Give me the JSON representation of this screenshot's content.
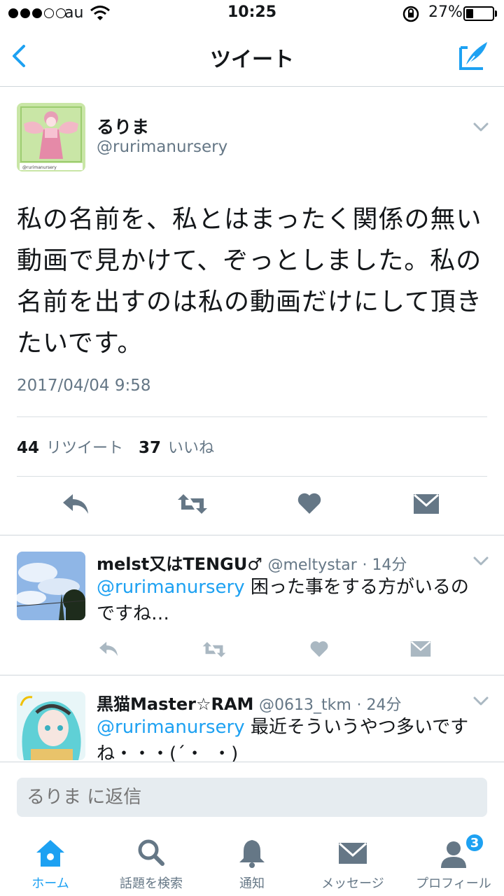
{
  "status_bar": {
    "carrier": "au",
    "time": "10:25",
    "battery_percent": "27%",
    "battery_level": 0.27
  },
  "nav": {
    "title": "ツイート",
    "back_icon": "chevron-left-icon",
    "compose_icon": "compose-tweet-icon"
  },
  "tweet": {
    "author_name": "るりま",
    "author_handle": "@rurimanursery",
    "text": "私の名前を、私とはまったく関係の無い動画で見かけて、ぞっとしました。私の名前を出すのは私の動画だけにして頂きたいです。",
    "timestamp": "2017/04/04 9:58",
    "retweet_count": "44",
    "retweet_label": "リツイート",
    "like_count": "37",
    "like_label": "いいね"
  },
  "replies": [
    {
      "name": "melst又はTENGU♂",
      "handle": "@meltystar",
      "time": "· 14分",
      "mention": "@rurimanursery",
      "text": " 困った事をする方がいるのですね…"
    },
    {
      "name": "黒猫Master☆RAM",
      "handle": "@0613_tkm",
      "time": "· 24分",
      "mention": "@rurimanursery",
      "text": " 最近そういうやつ多いですね・・・(´・_・)"
    }
  ],
  "reply_bar": {
    "placeholder": "るりま に返信"
  },
  "tabs": [
    {
      "label": "ホーム",
      "icon": "home-icon",
      "active": true
    },
    {
      "label": "話題を検索",
      "icon": "search-icon",
      "active": false
    },
    {
      "label": "通知",
      "icon": "bell-icon",
      "active": false
    },
    {
      "label": "メッセージ",
      "icon": "envelope-icon",
      "active": false
    },
    {
      "label": "プロフィール",
      "icon": "profile-icon",
      "active": false,
      "badge": "3"
    }
  ],
  "colors": {
    "accent": "#1da1f2",
    "secondary_text": "#657786",
    "action_icon": "#657786",
    "reply_action_icon": "#aab8c2"
  }
}
